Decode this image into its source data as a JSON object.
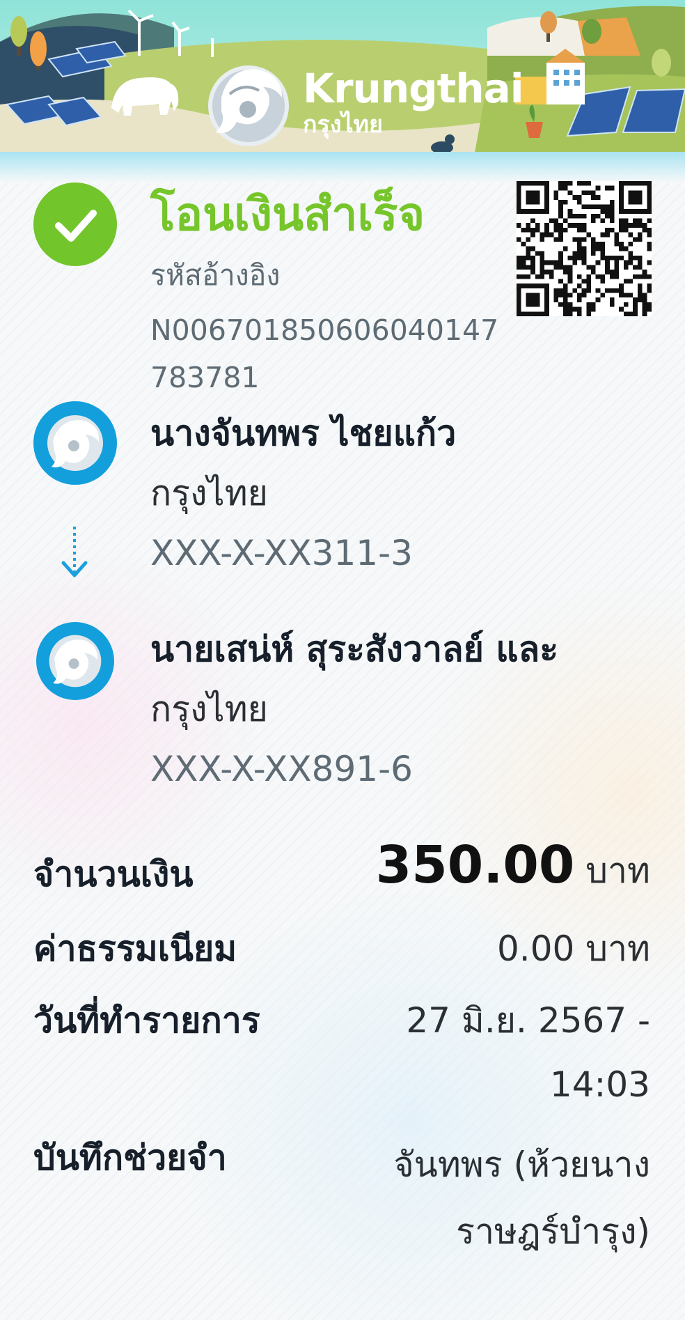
{
  "brand": {
    "name_en": "Krungthai",
    "name_th": "กรุงไทย"
  },
  "status": {
    "title": "โอนเงินสำเร็จ",
    "icon": "check-icon",
    "color": "#76c52a"
  },
  "reference": {
    "label": "รหัสอ้างอิง",
    "number": "N006701850606040147783781"
  },
  "sender": {
    "name": "นางจันทพร ไชยแก้ว",
    "bank": "กรุงไทย",
    "account": "XXX-X-XX311-3"
  },
  "receiver": {
    "name": "นายเสน่ห์ สุระสังวาลย์ และ",
    "bank": "กรุงไทย",
    "account": "XXX-X-XX891-6"
  },
  "details": {
    "amount_label": "จำนวนเงิน",
    "amount_value": "350.00",
    "amount_unit": "บาท",
    "fee_label": "ค่าธรรมเนียม",
    "fee_value": "0.00 บาท",
    "date_label": "วันที่ทำรายการ",
    "date_value": "27 มิ.ย. 2567 -",
    "time_value": "14:03",
    "note_label": "บันทึกช่วยจำ",
    "note_value": "จันทพร (ห้วยนางราษฎร์บำรุง)"
  },
  "colors": {
    "bank_blue": "#139fdc",
    "success_green": "#72c52a"
  }
}
